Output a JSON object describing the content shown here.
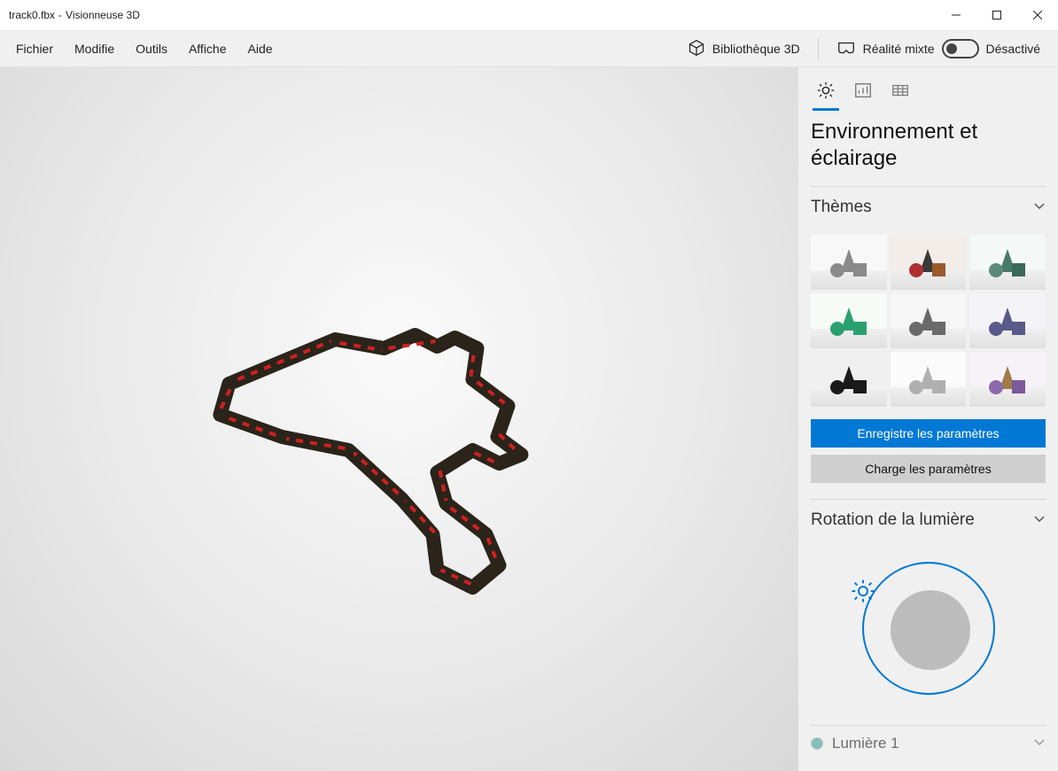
{
  "titlebar": {
    "filename": "track0.fbx",
    "separator": " - ",
    "app_name": "Visionneuse 3D"
  },
  "menu": {
    "file": "Fichier",
    "edit": "Modifie",
    "tools": "Outils",
    "display": "Affiche",
    "help": "Aide",
    "library_3d": "Bibliothèque 3D",
    "mixed_reality": "Réalité mixte",
    "mixed_reality_state": "Désactivé"
  },
  "panel": {
    "tabs": {
      "environment_icon": "sun-icon",
      "stats_icon": "stats-icon",
      "grid_icon": "grid-icon"
    },
    "title": "Environnement et éclairage",
    "themes_section": "Thèmes",
    "save_settings": "Enregistre les paramètres",
    "load_settings": "Charge les paramètres",
    "rotation_section": "Rotation de la lumière",
    "light1_label": "Lumière 1"
  },
  "themes": [
    {
      "cone": "#8a8a8a",
      "sphere": "#8a8a8a",
      "cube": "#8a8a8a",
      "bg": "#f8f8f8"
    },
    {
      "cone": "#3a3a3a",
      "sphere": "#b03030",
      "cube": "#9a5a2a",
      "bg": "#f2ede8"
    },
    {
      "cone": "#4a7a6a",
      "sphere": "#5a8a7a",
      "cube": "#3a6a5a",
      "bg": "#f4f8f7"
    },
    {
      "cone": "#2aa070",
      "sphere": "#2aa070",
      "cube": "#2aa070",
      "bg": "#f6fbf8"
    },
    {
      "cone": "#6a6a6a",
      "sphere": "#6a6a6a",
      "cube": "#6a6a6a",
      "bg": "#f6f6f6"
    },
    {
      "cone": "#5a5a8a",
      "sphere": "#5a5a8a",
      "cube": "#5a5a8a",
      "bg": "#f4f4f8"
    },
    {
      "cone": "#1a1a1a",
      "sphere": "#1a1a1a",
      "cube": "#1a1a1a",
      "bg": "#f0f0f0"
    },
    {
      "cone": "#b0b0b0",
      "sphere": "#b0b0b0",
      "cube": "#b0b0b0",
      "bg": "#fbfbfb"
    },
    {
      "cone": "#a07a4a",
      "sphere": "#8a6aaa",
      "cube": "#7a5a9a",
      "bg": "#f6f2f8"
    }
  ]
}
